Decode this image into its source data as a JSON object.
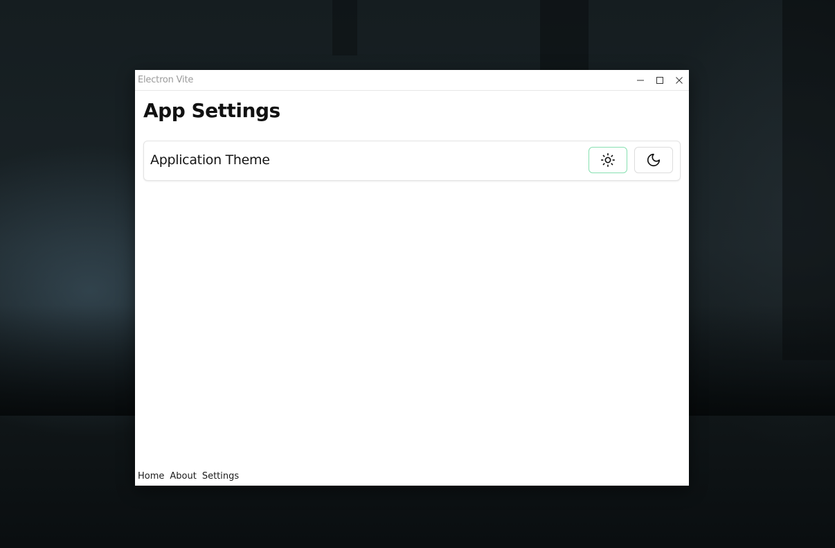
{
  "window": {
    "title": "Electron Vite",
    "controls": {
      "minimize_icon": "minimize-icon",
      "maximize_icon": "maximize-icon",
      "close_icon": "close-icon"
    }
  },
  "page": {
    "title": "App Settings"
  },
  "settings": {
    "theme": {
      "label": "Application Theme",
      "options": [
        {
          "icon": "sun-icon",
          "value": "light",
          "selected": true
        },
        {
          "icon": "moon-icon",
          "value": "dark",
          "selected": false
        }
      ],
      "selected_border_color": "#86e0b0"
    }
  },
  "footer": {
    "links": [
      "Home",
      "About",
      "Settings"
    ]
  }
}
